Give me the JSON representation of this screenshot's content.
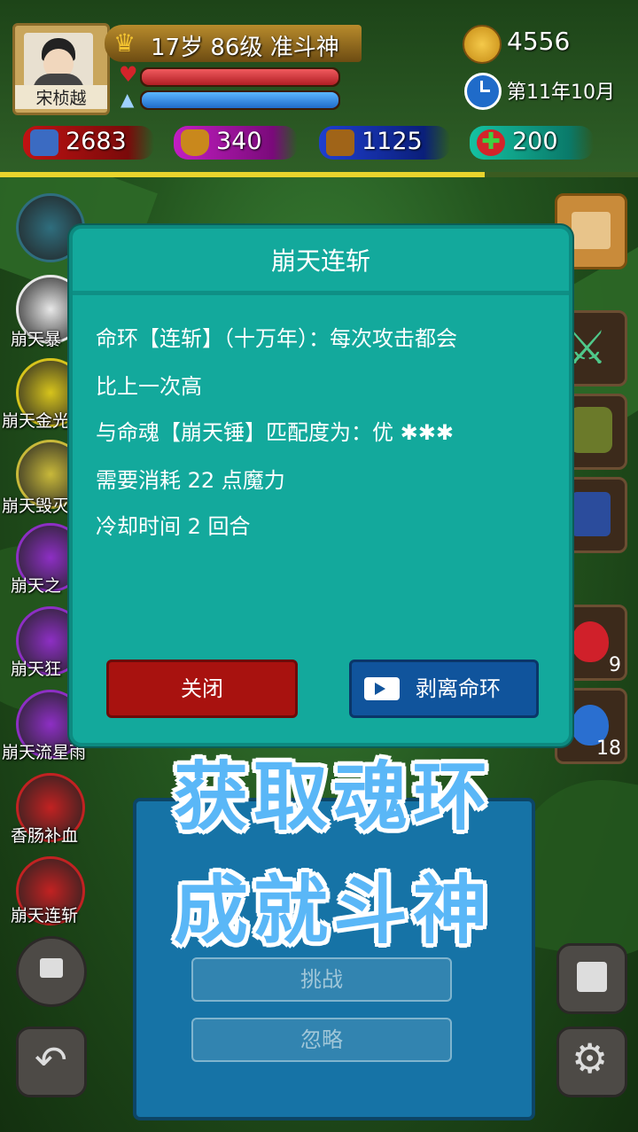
{
  "player": {
    "name": "宋桢越",
    "level_info": "17岁 86级 准斗神",
    "hp_fraction": 1.0,
    "mp_fraction": 1.0,
    "gold": "4556",
    "date": "第11年10月",
    "xp_fraction": 0.76
  },
  "stats": {
    "attack": "2683",
    "defense": "340",
    "speed": "1125",
    "heal": "200"
  },
  "skills": [
    {
      "label": "",
      "icon": "hammer-icon",
      "color": "#2f6e7e"
    },
    {
      "label": "崩天暴",
      "icon": "fist-icon",
      "color": "#e8e8e8"
    },
    {
      "label": "崩天金光",
      "icon": "gold-ring-icon",
      "color": "#d7c41c"
    },
    {
      "label": "崩天毁灭",
      "icon": "kill-rune-icon",
      "color": "#c9b93a"
    },
    {
      "label": "崩天之",
      "icon": "purple-rune-icon",
      "color": "#8d2fc4"
    },
    {
      "label": "崩天狂",
      "icon": "purple-hammer-icon",
      "color": "#8d2fc4"
    },
    {
      "label": "崩天流星雨",
      "icon": "meteor-icon",
      "color": "#8d2fc4"
    },
    {
      "label": "香肠补血",
      "icon": "sausage-icon",
      "color": "#c22222"
    },
    {
      "label": "崩天连斩",
      "icon": "slash-icon",
      "color": "#c22222"
    }
  ],
  "inventory": {
    "potion_red_count": "9",
    "potion_blue_count": "18"
  },
  "background_panel": {
    "challenge_label": "挑战",
    "ignore_label": "忽略"
  },
  "dialog": {
    "title": "崩天连斩",
    "lines": [
      "命环【连斩】（十万年）：每次攻击都会",
      "比上一次高",
      "与命魂【崩天锤】匹配度为：优 ✱✱✱",
      "需要消耗 22 点魔力",
      "冷却时间 2 回合"
    ],
    "close_label": "关闭",
    "strip_label": "剥离命环"
  },
  "promo": {
    "line1": "获取魂环",
    "line2": "成就斗神"
  },
  "colors": {
    "dialog_bg": "#13a99c",
    "close_btn": "#a8120f",
    "strip_btn": "#10549c",
    "promo_text": "#5ab7f7"
  }
}
